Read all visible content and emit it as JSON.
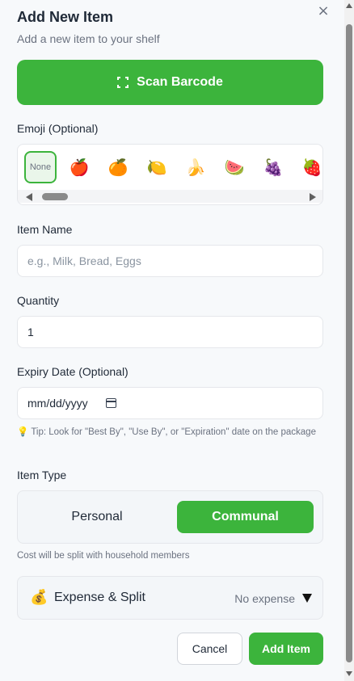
{
  "header": {
    "title": "Add New Item",
    "subtitle": "Add a new item to your shelf",
    "close_icon": "×"
  },
  "scan": {
    "label": "Scan Barcode",
    "icon": "scan-frame-icon"
  },
  "emoji": {
    "label": "Emoji (Optional)",
    "selected": "None",
    "options": [
      "None",
      "🍎",
      "🍊",
      "🍋",
      "🍌",
      "🍉",
      "🍇",
      "🍓"
    ]
  },
  "item_name": {
    "label": "Item Name",
    "placeholder": "e.g., Milk, Bread, Eggs"
  },
  "quantity": {
    "label": "Quantity",
    "value": "1"
  },
  "expiry": {
    "label": "Expiry Date (Optional)",
    "placeholder": "mm/dd/yyyy",
    "tip_icon": "💡",
    "tip": "Tip: Look for \"Best By\", \"Use By\", or \"Expiration\" date on the package"
  },
  "item_type": {
    "label": "Item Type",
    "options": [
      "Personal",
      "Communal"
    ],
    "selected": "Communal",
    "note": "Cost will be split with household members"
  },
  "expense": {
    "icon": "💰",
    "label": "Expense & Split",
    "value": "No expense"
  },
  "actions": {
    "cancel": "Cancel",
    "add": "Add Item"
  },
  "colors": {
    "accent": "#3cb43c",
    "background": "#f7f9fb"
  }
}
